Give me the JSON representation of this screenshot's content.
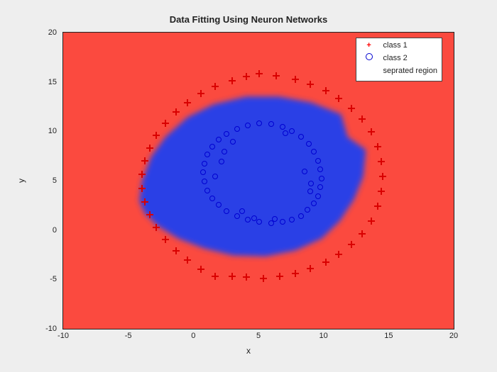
{
  "chart_data": {
    "type": "scatter",
    "title": "Data Fitting Using Neuron Networks",
    "xlabel": "x",
    "ylabel": "y",
    "xlim": [
      -10,
      20
    ],
    "ylim": [
      -10,
      20
    ],
    "xticks": [
      -10,
      -5,
      0,
      5,
      10,
      15,
      20
    ],
    "yticks": [
      -10,
      -5,
      0,
      5,
      10,
      15,
      20
    ],
    "legend_position": "top-right",
    "region": {
      "description": "Decision surface: interior blob → class 2 (blue), exterior → class 1 (red)",
      "blue_blob_path_xy": [
        [
          -4.2,
          3.0
        ],
        [
          -4.0,
          5.0
        ],
        [
          -3.3,
          7.5
        ],
        [
          -2.2,
          9.5
        ],
        [
          -0.5,
          11.5
        ],
        [
          1.5,
          12.8
        ],
        [
          4.0,
          13.6
        ],
        [
          6.5,
          13.6
        ],
        [
          9.0,
          13.0
        ],
        [
          11.3,
          11.8
        ],
        [
          11.8,
          9.5
        ],
        [
          13.2,
          8.2
        ],
        [
          13.0,
          5.5
        ],
        [
          12.3,
          3.2
        ],
        [
          11.2,
          1.0
        ],
        [
          9.8,
          -0.8
        ],
        [
          7.8,
          -2.0
        ],
        [
          5.5,
          -2.6
        ],
        [
          3.0,
          -2.5
        ],
        [
          0.8,
          -1.8
        ],
        [
          -1.2,
          -0.8
        ],
        [
          -2.8,
          0.5
        ],
        [
          -3.8,
          1.8
        ]
      ]
    },
    "series": [
      {
        "name": "class 1",
        "marker": "plus",
        "color": "#ff0000",
        "points_xy": [
          [
            5.0,
            15.9
          ],
          [
            6.3,
            15.7
          ],
          [
            4.0,
            15.6
          ],
          [
            2.9,
            15.2
          ],
          [
            7.8,
            15.3
          ],
          [
            1.6,
            14.6
          ],
          [
            8.9,
            14.8
          ],
          [
            0.5,
            13.9
          ],
          [
            10.1,
            14.2
          ],
          [
            -0.5,
            13.0
          ],
          [
            11.1,
            13.4
          ],
          [
            -1.4,
            12.0
          ],
          [
            12.1,
            12.4
          ],
          [
            -2.2,
            10.9
          ],
          [
            12.9,
            11.3
          ],
          [
            -2.9,
            9.7
          ],
          [
            13.6,
            10.0
          ],
          [
            -3.4,
            8.4
          ],
          [
            14.1,
            8.5
          ],
          [
            -3.8,
            7.1
          ],
          [
            14.4,
            7.0
          ],
          [
            -4.0,
            5.7
          ],
          [
            14.5,
            5.5
          ],
          [
            -4.0,
            4.3
          ],
          [
            14.4,
            4.0
          ],
          [
            -3.8,
            2.9
          ],
          [
            14.1,
            2.5
          ],
          [
            -3.4,
            1.6
          ],
          [
            13.6,
            1.0
          ],
          [
            -2.9,
            0.3
          ],
          [
            12.9,
            -0.3
          ],
          [
            -2.2,
            -0.9
          ],
          [
            12.1,
            -1.4
          ],
          [
            -1.4,
            -2.0
          ],
          [
            11.1,
            -2.4
          ],
          [
            -0.5,
            -3.0
          ],
          [
            10.1,
            -3.2
          ],
          [
            0.5,
            -3.9
          ],
          [
            8.9,
            -3.8
          ],
          [
            1.6,
            -4.6
          ],
          [
            7.8,
            -4.3
          ],
          [
            2.9,
            -4.6
          ],
          [
            6.6,
            -4.6
          ],
          [
            4.0,
            -4.7
          ],
          [
            5.3,
            -4.8
          ]
        ]
      },
      {
        "name": "class 2",
        "marker": "circle",
        "color": "#0000ff",
        "points_xy": [
          [
            5.0,
            10.9
          ],
          [
            5.9,
            10.8
          ],
          [
            4.1,
            10.7
          ],
          [
            6.8,
            10.5
          ],
          [
            3.3,
            10.3
          ],
          [
            7.5,
            10.1
          ],
          [
            2.5,
            9.8
          ],
          [
            8.2,
            9.5
          ],
          [
            1.9,
            9.2
          ],
          [
            8.8,
            8.8
          ],
          [
            1.4,
            8.5
          ],
          [
            9.2,
            8.0
          ],
          [
            1.0,
            7.7
          ],
          [
            9.5,
            7.1
          ],
          [
            0.8,
            6.8
          ],
          [
            9.7,
            6.2
          ],
          [
            0.7,
            5.9
          ],
          [
            9.8,
            5.3
          ],
          [
            0.8,
            5.0
          ],
          [
            9.7,
            4.4
          ],
          [
            1.0,
            4.1
          ],
          [
            9.5,
            3.5
          ],
          [
            1.4,
            3.3
          ],
          [
            9.2,
            2.8
          ],
          [
            1.9,
            2.6
          ],
          [
            8.7,
            2.1
          ],
          [
            2.5,
            2.0
          ],
          [
            8.2,
            1.5
          ],
          [
            3.3,
            1.5
          ],
          [
            7.5,
            1.1
          ],
          [
            4.1,
            1.1
          ],
          [
            6.8,
            0.9
          ],
          [
            5.0,
            0.9
          ],
          [
            5.9,
            0.8
          ],
          [
            2.1,
            7.0
          ],
          [
            2.3,
            8.0
          ],
          [
            3.0,
            9.0
          ],
          [
            7.0,
            9.9
          ],
          [
            8.5,
            6.0
          ],
          [
            9.0,
            4.8
          ],
          [
            8.9,
            4.0
          ],
          [
            6.2,
            1.2
          ],
          [
            4.6,
            1.3
          ],
          [
            3.7,
            2.0
          ],
          [
            1.6,
            5.5
          ]
        ]
      },
      {
        "name": "seprated region",
        "marker": "region",
        "colors": {
          "class1": "#fb4a3f",
          "class2": "#2a3fe6"
        }
      }
    ]
  },
  "legend": {
    "entries": [
      {
        "label": "class 1",
        "key": "class1"
      },
      {
        "label": "class 2",
        "key": "class2"
      },
      {
        "label": "seprated region",
        "key": "region"
      }
    ]
  }
}
